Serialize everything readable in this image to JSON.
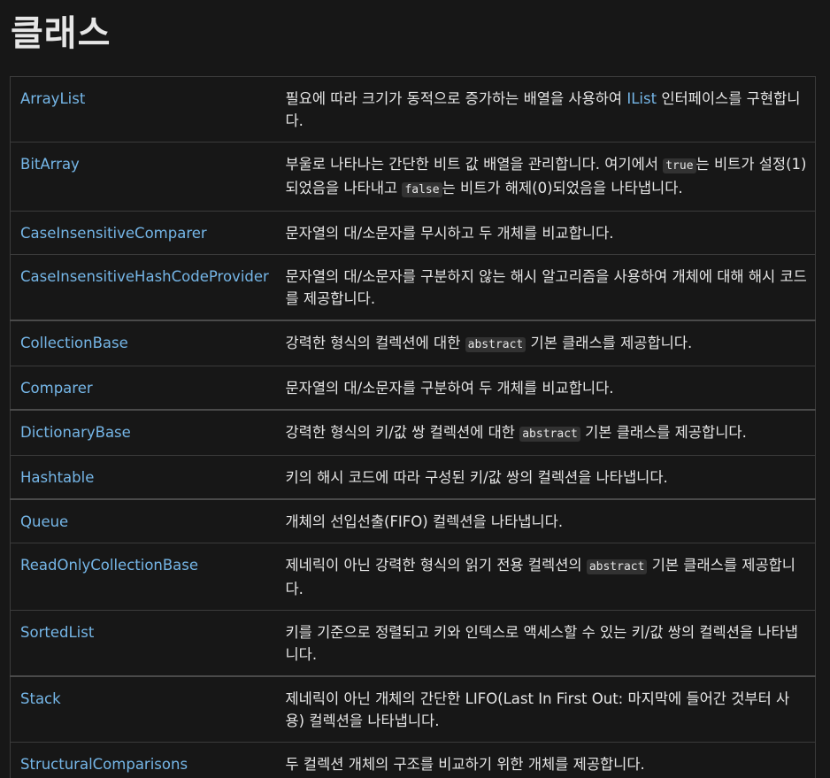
{
  "page_title": "클래스",
  "rows": [
    {
      "name": "ArrayList",
      "d1": "필요에 따라 크기가 동적으로 증가하는 배열을 사용하여 ",
      "link": "IList",
      "d2": " 인터페이스를 구현합니다."
    },
    {
      "name": "BitArray",
      "d1": "부울로 나타나는 간단한 비트 값 배열을 관리합니다. 여기에서 ",
      "code1": "true",
      "d2": "는 비트가 설정(1)되었음을 나타내고 ",
      "code2": "false",
      "d3": "는 비트가 해제(0)되었음을 나타냅니다."
    },
    {
      "name": "CaseInsensitiveComparer",
      "d1": "문자열의 대/소문자를 무시하고 두 개체를 비교합니다."
    },
    {
      "name": "CaseInsensitiveHashCodeProvider",
      "d1": "문자열의 대/소문자를 구분하지 않는 해시 알고리즘을 사용하여 개체에 대해 해시 코드를 제공합니다."
    },
    {
      "name": "CollectionBase",
      "d1": "강력한 형식의 컬렉션에 대한 ",
      "code1": "abstract",
      "d2": " 기본 클래스를 제공합니다."
    },
    {
      "name": "Comparer",
      "d1": "문자열의 대/소문자를 구분하여 두 개체를 비교합니다."
    },
    {
      "name": "DictionaryBase",
      "d1": "강력한 형식의 키/값 쌍 컬렉션에 대한 ",
      "code1": "abstract",
      "d2": " 기본 클래스를 제공합니다."
    },
    {
      "name": "Hashtable",
      "d1": "키의 해시 코드에 따라 구성된 키/값 쌍의 컬렉션을 나타냅니다."
    },
    {
      "name": "Queue",
      "d1": "개체의 선입선출(FIFO) 컬렉션을 나타냅니다."
    },
    {
      "name": "ReadOnlyCollectionBase",
      "d1": "제네릭이 아닌 강력한 형식의 읽기 전용 컬렉션의 ",
      "code1": "abstract",
      "d2": " 기본 클래스를 제공합니다."
    },
    {
      "name": "SortedList",
      "d1": "키를 기준으로 정렬되고 키와 인덱스로 액세스할 수 있는 키/값 쌍의 컬렉션을 나타냅니다."
    },
    {
      "name": "Stack",
      "d1": "제네릭이 아닌 개체의 간단한 LIFO(Last In First Out: 마지막에 들어간 것부터 사용) 컬렉션을 나타냅니다."
    },
    {
      "name": "StructuralComparisons",
      "d1": "두 컬렉션 개체의 구조를 비교하기 위한 개체를 제공합니다."
    }
  ]
}
